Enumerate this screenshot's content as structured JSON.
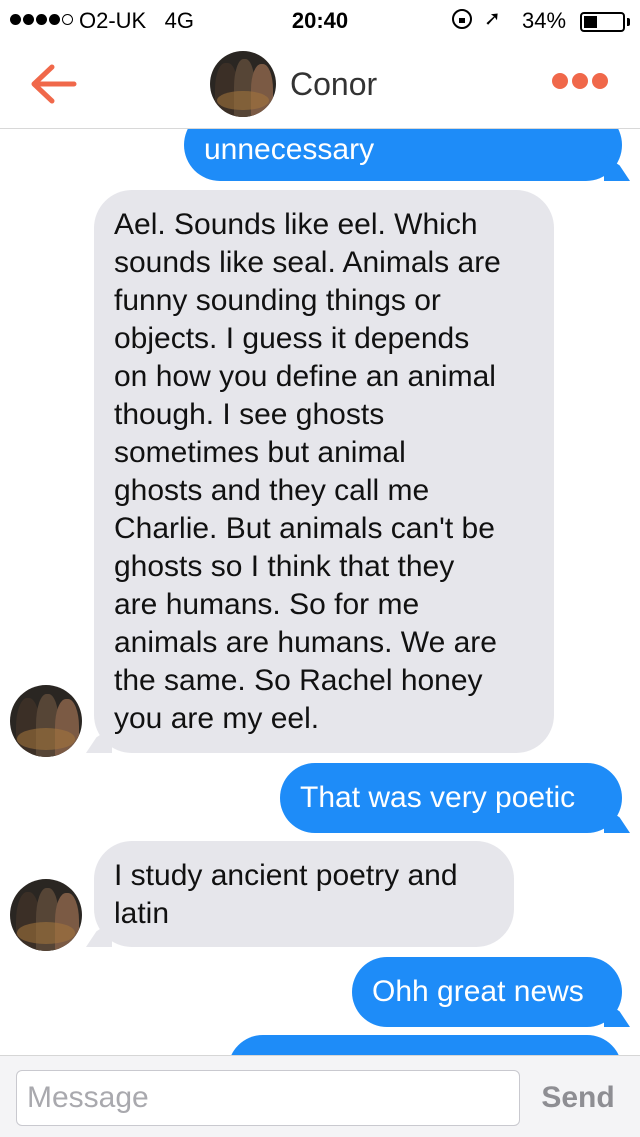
{
  "status_bar": {
    "carrier": "O2-UK",
    "network": "4G",
    "time": "20:40",
    "battery_percent": "34%",
    "icons": [
      "signal-dots",
      "orientation-lock-icon",
      "location-arrow-icon",
      "battery-icon"
    ]
  },
  "header": {
    "contact_name": "Conor",
    "accent_color": "#f0684a"
  },
  "messages": [
    {
      "direction": "outgoing",
      "text": "unnecessary"
    },
    {
      "direction": "incoming",
      "lines": [
        "Ael. Sounds like eel. Which",
        "sounds like seal. Animals are",
        "funny sounding things or",
        "objects. I guess it depends",
        "on how you define an animal",
        "though. I see ghosts",
        "sometimes but animal",
        "ghosts and they call me",
        "Charlie. But animals can't be",
        "ghosts so I think that they",
        "are humans. So for me",
        "animals are humans. We are",
        "the same. So Rachel honey",
        "you are my eel."
      ]
    },
    {
      "direction": "outgoing",
      "text": "That was very poetic"
    },
    {
      "direction": "incoming",
      "lines": [
        "I study ancient poetry and",
        "latin"
      ]
    },
    {
      "direction": "outgoing",
      "text": "Ohh great news"
    },
    {
      "direction": "outgoing",
      "text": ""
    }
  ],
  "colors": {
    "outgoing_bubble": "#1e8cf8",
    "incoming_bubble": "#e6e6eb"
  },
  "input": {
    "placeholder": "Message",
    "value": "",
    "send_label": "Send"
  }
}
